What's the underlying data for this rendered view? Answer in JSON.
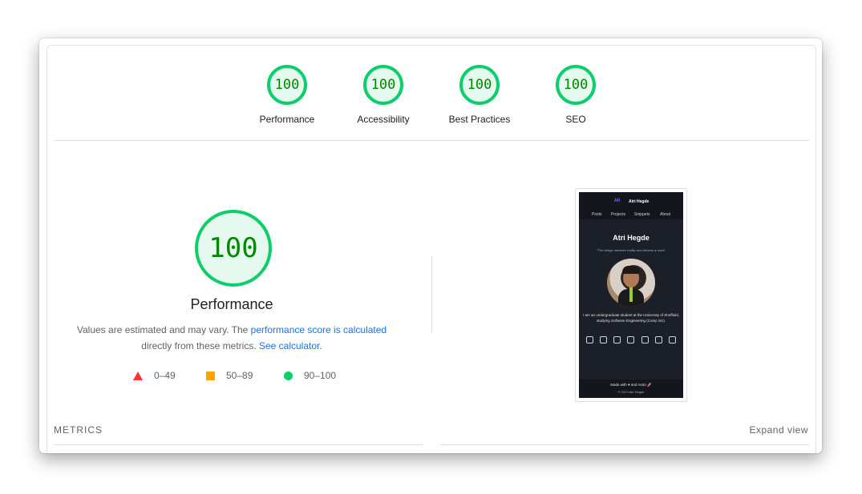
{
  "gauges": [
    {
      "score": "100",
      "label": "Performance"
    },
    {
      "score": "100",
      "label": "Accessibility"
    },
    {
      "score": "100",
      "label": "Best Practices"
    },
    {
      "score": "100",
      "label": "SEO"
    }
  ],
  "performance": {
    "score": "100",
    "title": "Performance",
    "desc_prefix": "Values are estimated and may vary. The ",
    "desc_link": "performance score is calculated",
    "desc_mid": "directly from these metrics. ",
    "calc_link": "See calculator",
    "desc_suffix": "."
  },
  "legend": [
    {
      "range": "0–49",
      "shape": "triangle",
      "color": "#ff3333"
    },
    {
      "range": "50–89",
      "shape": "square",
      "color": "#ffa400"
    },
    {
      "range": "90–100",
      "shape": "circle",
      "color": "#0cce6b"
    }
  ],
  "screenshot": {
    "logo": "AH",
    "site_name": "Atri Hegde",
    "nav": [
      "Posts",
      "Projects",
      "Snippets",
      "About"
    ],
    "title": "Atri Hegde",
    "quote": "\"The bridge between reality and dreams is work\"",
    "bio": "I am an undergraduate student at the University of Sheffield, studying Software Engineering (Comp Sci).",
    "footer_made": "Made with ♥ and Astro 🚀",
    "footer_copy": "© 2023 Atri Hegde"
  },
  "metrics_title": "METRICS",
  "expand_label": "Expand view",
  "colors": {
    "pass": "#0cce6b",
    "pass_text": "#008800",
    "link": "#1a73e8"
  }
}
